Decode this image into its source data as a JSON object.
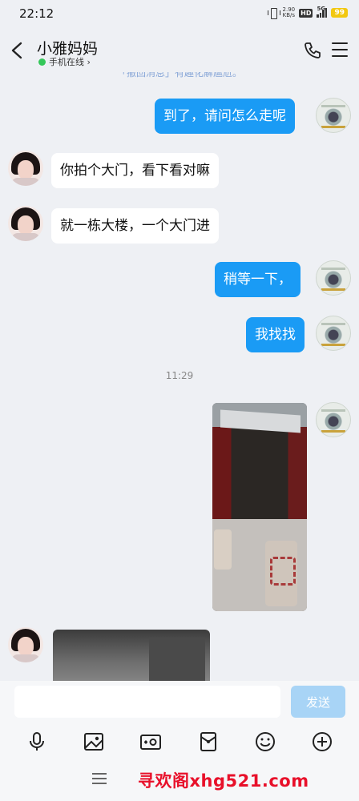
{
  "status_bar": {
    "time": "22:12",
    "net_speed_value": "2.90",
    "net_speed_unit": "KB/s",
    "hd_badge": "HD",
    "signal_label": "5G",
    "battery": "99",
    "battery_color": "#f2c811"
  },
  "header": {
    "contact_name": "小雅妈妈",
    "presence": "手机在线 ›",
    "back_icon": "chevron-left-icon",
    "call_icon": "phone-icon",
    "more_icon": "menu-icon"
  },
  "chat": {
    "system_notice": "「撤回消息」有趣化解尴尬。",
    "timestamp": "11:29",
    "messages": [
      {
        "sender": "me",
        "text": "到了，请问怎么走呢"
      },
      {
        "sender": "friend",
        "text": "你拍个大门，看下看对嘛"
      },
      {
        "sender": "friend",
        "text": "就一栋大楼，一个大门进"
      },
      {
        "sender": "me",
        "text": "稍等一下，"
      },
      {
        "sender": "me",
        "text": "我找找"
      },
      {
        "sender": "me",
        "type": "image"
      },
      {
        "sender": "friend",
        "type": "image"
      }
    ]
  },
  "input": {
    "value": "",
    "send_label": "发送"
  },
  "toolbar": {
    "icons": [
      "microphone-icon",
      "image-icon",
      "camera-icon",
      "red-packet-icon",
      "emoji-icon",
      "plus-icon"
    ]
  },
  "watermark": "寻欢阁xhg521.com",
  "colors": {
    "accent": "#1a9bf5",
    "send_disabled": "#a8d4f6",
    "background": "#eef0f4",
    "watermark": "#e8102a",
    "online": "#34c759"
  }
}
